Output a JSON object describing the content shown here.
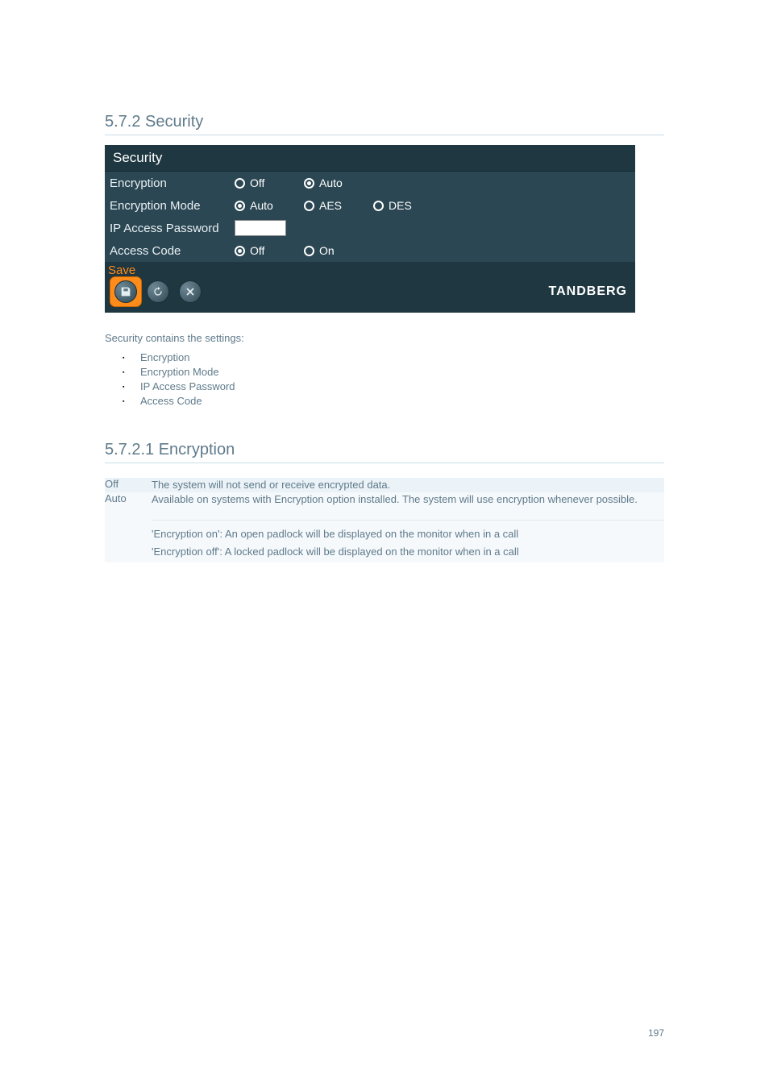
{
  "section_heading": "5.7.2 Security",
  "panel": {
    "title": "Security",
    "rows": {
      "encryption": {
        "label": "Encryption",
        "options": [
          {
            "label": "Off",
            "checked": false
          },
          {
            "label": "Auto",
            "checked": true
          }
        ]
      },
      "encryption_mode": {
        "label": "Encryption Mode",
        "options": [
          {
            "label": "Auto",
            "checked": true
          },
          {
            "label": "AES",
            "checked": false
          },
          {
            "label": "DES",
            "checked": false
          }
        ]
      },
      "ip_password": {
        "label": "IP Access Password",
        "value": ""
      },
      "access_code": {
        "label": "Access Code",
        "options": [
          {
            "label": "Off",
            "checked": true
          },
          {
            "label": "On",
            "checked": false
          }
        ]
      }
    },
    "save_label": "Save",
    "brand": "TANDBERG"
  },
  "links_intro": "Security contains the settings:",
  "links": [
    "Encryption",
    "Encryption Mode",
    "IP Access Password",
    "Access Code"
  ],
  "subsection_heading": "5.7.2.1 Encryption",
  "options": {
    "off": {
      "key": "Off",
      "desc": "The system will not send or receive encrypted data."
    },
    "auto": {
      "key": "Auto",
      "main": "Available on systems with Encryption option installed. The system will use encryption whenever possible.",
      "sub1": "'Encryption on': An open padlock will be displayed on the monitor when in a call",
      "sub2": "'Encryption off': A locked padlock will be displayed on the monitor when in a call"
    }
  },
  "page_number": "197"
}
